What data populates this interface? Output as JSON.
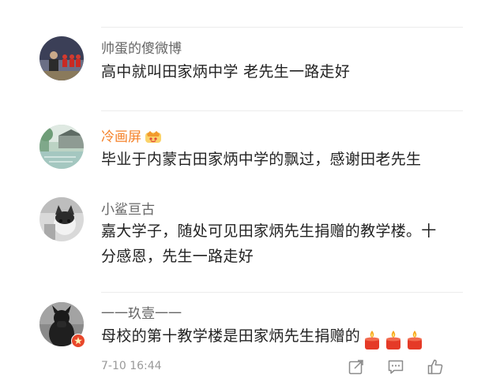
{
  "colors": {
    "username_default": "#666666",
    "username_vip": "#f5822a",
    "comment_text": "#222222",
    "timestamp": "#999999",
    "divider": "#ececec"
  },
  "comments": [
    {
      "username": "帅蛋的傻微博",
      "text": "高中就叫田家炳中学 老先生一路走好",
      "avatar_icon": "avatar-photo-group-icon"
    },
    {
      "username": "冷画屏",
      "badge_icon": "vip-crown-badge-icon",
      "text": "毕业于内蒙古田家炳中学的飘过，感谢田老先生",
      "avatar_icon": "avatar-photo-waterside-town-icon"
    },
    {
      "username": "小鲨亘古",
      "text": "嘉大学子，随处可见田家炳先生捐赠的教学楼。十分感恩，先生一路走好",
      "avatar_icon": "avatar-photo-cat-icon"
    },
    {
      "username": "一一玖壹一一",
      "text": "母校的第十教学楼是田家炳先生捐赠的",
      "emoji": [
        "candle-emoji",
        "candle-emoji",
        "candle-emoji"
      ],
      "avatar_icon": "avatar-photo-black-dog-icon",
      "verified_icon": "red-verified-badge-icon"
    }
  ],
  "footer": {
    "timestamp": "7-10 16:44",
    "actions": [
      "share-icon",
      "comment-icon",
      "like-icon"
    ]
  }
}
